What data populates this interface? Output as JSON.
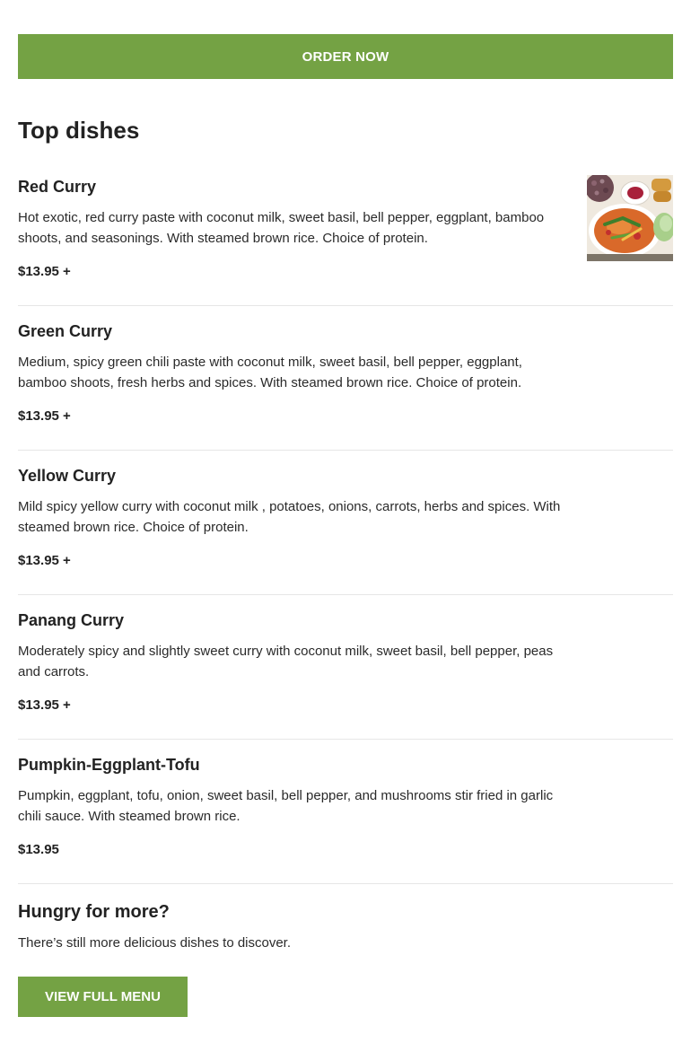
{
  "order_button": {
    "label": "ORDER NOW"
  },
  "top_dishes": {
    "title": "Top dishes",
    "dishes": [
      {
        "name": "Red Curry",
        "description": "Hot exotic, red curry paste with coconut milk, sweet basil, bell pepper, eggplant, bamboo shoots, and seasonings. With steamed brown rice. Choice of protein.",
        "price": "$13.95 +",
        "has_photo": true
      },
      {
        "name": "Green Curry",
        "description": "Medium, spicy green chili paste with coconut milk, sweet basil, bell pepper, eggplant, bamboo shoots, fresh herbs and spices. With steamed brown rice. Choice of protein.",
        "price": "$13.95 +"
      },
      {
        "name": "Yellow Curry",
        "description": "Mild spicy yellow curry with coconut milk , potatoes, onions, carrots, herbs and spices. With steamed brown rice. Choice of protein.",
        "price": "$13.95 +"
      },
      {
        "name": "Panang Curry",
        "description": "Moderately spicy and slightly sweet curry with coconut milk, sweet basil, bell pepper, peas and carrots.",
        "price": "$13.95 +"
      },
      {
        "name": "Pumpkin-Eggplant-Tofu",
        "description": "Pumpkin, eggplant, tofu, onion, sweet basil, bell pepper, and mushrooms stir fried in garlic chili sauce. With steamed brown rice.",
        "price": "$13.95"
      }
    ]
  },
  "more": {
    "title": "Hungry for more?",
    "text": "There’s still more delicious dishes to discover.",
    "button_label": "VIEW FULL MENU"
  },
  "colors": {
    "accent": "#74a244",
    "text": "#222222",
    "divider": "#e6e6e6"
  }
}
